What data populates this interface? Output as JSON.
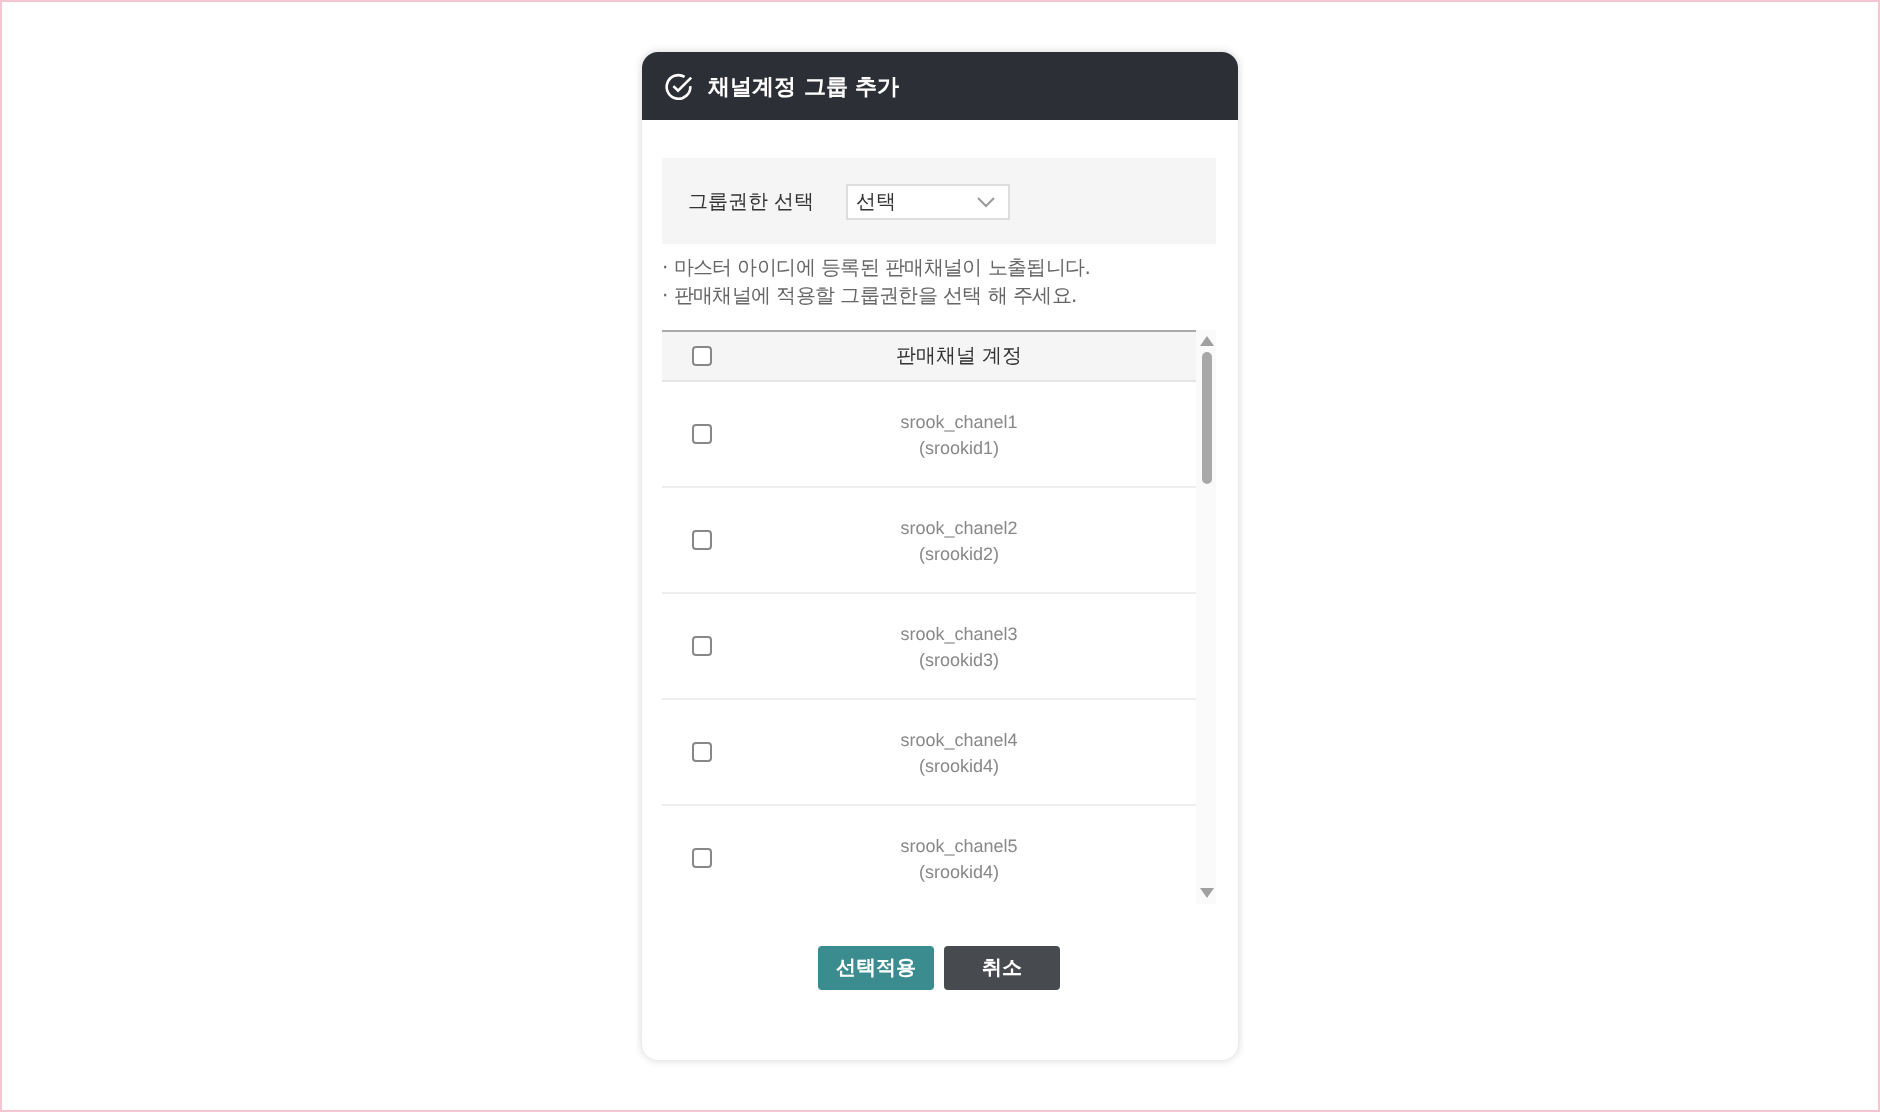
{
  "dialog": {
    "title": "채널계정 그룹 추가"
  },
  "filter": {
    "label": "그룹권한 선택",
    "select_value": "선택"
  },
  "notes": [
    "· 마스터 아이디에 등록된 판매채널이 노출됩니다.",
    "· 판매채널에 적용할 그룹권한을 선택 해 주세요."
  ],
  "table": {
    "select_all_checked": false,
    "column": "판매채널 계정",
    "rows": [
      {
        "channel": "srook_chanel1",
        "id": "(srookid1)",
        "checked": false
      },
      {
        "channel": "srook_chanel2",
        "id": "(srookid2)",
        "checked": false
      },
      {
        "channel": "srook_chanel3",
        "id": "(srookid3)",
        "checked": false
      },
      {
        "channel": "srook_chanel4",
        "id": "(srookid4)",
        "checked": false
      },
      {
        "channel": "srook_chanel5",
        "id": "(srookid4)",
        "checked": false
      }
    ]
  },
  "buttons": [
    {
      "label": "선택적용",
      "kind": "primary"
    },
    {
      "label": "취소",
      "kind": "secondary"
    }
  ]
}
